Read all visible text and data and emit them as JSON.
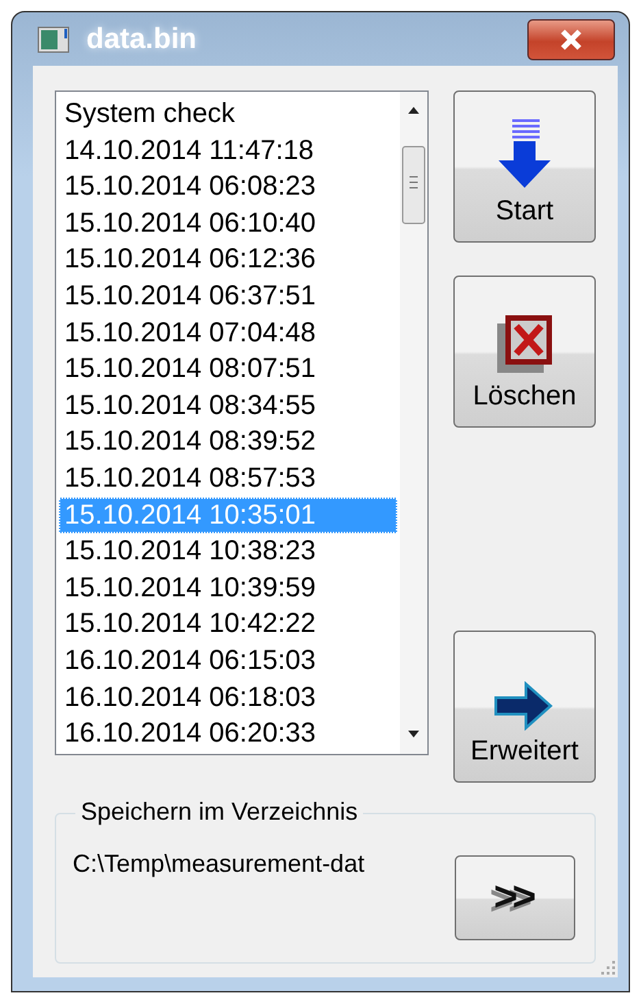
{
  "window": {
    "title": "data.bin"
  },
  "list": {
    "items": [
      {
        "text": "System check",
        "selected": false
      },
      {
        "text": "14.10.2014 11:47:18",
        "selected": false
      },
      {
        "text": "15.10.2014 06:08:23",
        "selected": false
      },
      {
        "text": "15.10.2014 06:10:40",
        "selected": false
      },
      {
        "text": "15.10.2014 06:12:36",
        "selected": false
      },
      {
        "text": "15.10.2014 06:37:51",
        "selected": false
      },
      {
        "text": "15.10.2014 07:04:48",
        "selected": false
      },
      {
        "text": "15.10.2014 08:07:51",
        "selected": false
      },
      {
        "text": "15.10.2014 08:34:55",
        "selected": false
      },
      {
        "text": "15.10.2014 08:39:52",
        "selected": false
      },
      {
        "text": "15.10.2014 08:57:53",
        "selected": false
      },
      {
        "text": "15.10.2014 10:35:01",
        "selected": true
      },
      {
        "text": "15.10.2014 10:38:23",
        "selected": false
      },
      {
        "text": "15.10.2014 10:39:59",
        "selected": false
      },
      {
        "text": "15.10.2014 10:42:22",
        "selected": false
      },
      {
        "text": "16.10.2014 06:15:03",
        "selected": false
      },
      {
        "text": "16.10.2014 06:18:03",
        "selected": false
      },
      {
        "text": "16.10.2014 06:20:33",
        "selected": false
      }
    ]
  },
  "buttons": [
    {
      "kind": "start",
      "label": "Start"
    },
    {
      "kind": "delete",
      "label": "Löschen"
    },
    {
      "kind": "spacer"
    },
    {
      "kind": "extended",
      "label": "Erweitert"
    }
  ],
  "save_group": {
    "title": "Speichern im Verzeichnis",
    "path": "C:\\Temp\\measurement-dat",
    "browse_button": ">>"
  }
}
